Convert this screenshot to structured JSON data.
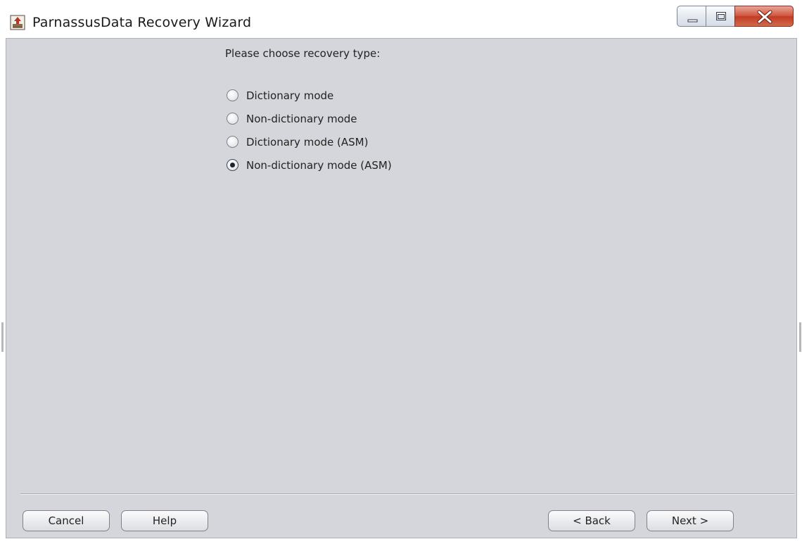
{
  "window": {
    "title": "ParnassusData Recovery Wizard",
    "icon": "app-icon",
    "controls": [
      "minimize-icon",
      "maximize-icon",
      "close-icon"
    ]
  },
  "content": {
    "prompt": "Please choose recovery type:",
    "options": [
      {
        "label": "Dictionary mode",
        "selected": false
      },
      {
        "label": "Non-dictionary mode",
        "selected": false
      },
      {
        "label": "Dictionary mode (ASM)",
        "selected": false
      },
      {
        "label": "Non-dictionary mode (ASM)",
        "selected": true
      }
    ]
  },
  "buttons": {
    "cancel": "Cancel",
    "help": "Help",
    "back": "< Back",
    "next": "Next >"
  },
  "colors": {
    "client_bg": "#d4d6db",
    "close_button": "#c94a32"
  }
}
